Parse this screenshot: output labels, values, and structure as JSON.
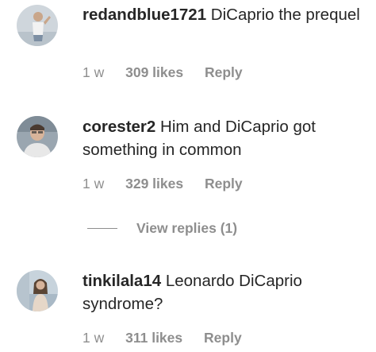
{
  "comments": [
    {
      "username": "redandblue1721",
      "text": "DiCaprio the prequel",
      "time": "1 w",
      "likes": "309 likes",
      "reply": "Reply"
    },
    {
      "username": "corester2",
      "text": "Him and DiCaprio got something in common",
      "time": "1 w",
      "likes": "329 likes",
      "reply": "Reply",
      "view_replies": "View replies (1)"
    },
    {
      "username": "tinkilala14",
      "text": "Leonardo DiCaprio syndrome?",
      "time": "1 w",
      "likes": "311 likes",
      "reply": "Reply"
    }
  ],
  "colors": {
    "text": "#262626",
    "secondary": "#8e8e8e"
  }
}
